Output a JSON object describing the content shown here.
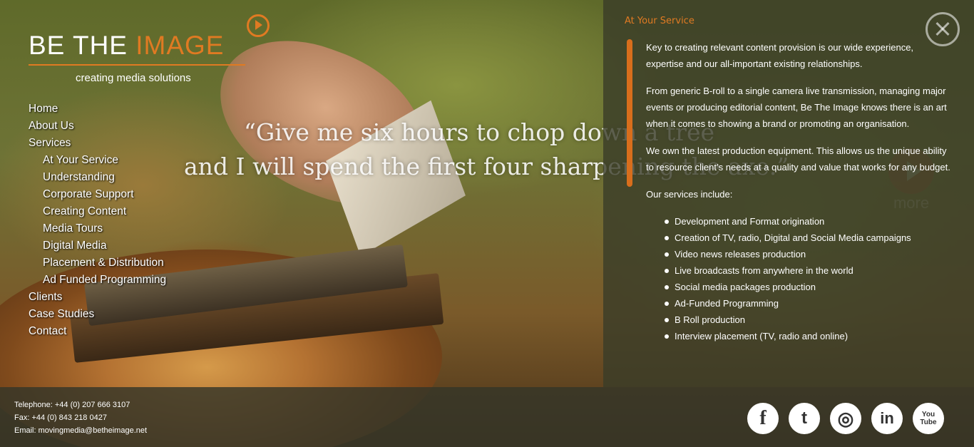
{
  "brand": {
    "logo_part1": "BE THE ",
    "logo_part2": "IMAGE",
    "tagline": "creating media solutions",
    "accent_color": "#e07a22"
  },
  "nav": {
    "items": [
      {
        "label": "Home",
        "level": 1
      },
      {
        "label": "About Us",
        "level": 1
      },
      {
        "label": "Services",
        "level": 1
      },
      {
        "label": "At Your Service",
        "level": 2
      },
      {
        "label": "Understanding",
        "level": 2
      },
      {
        "label": "Corporate Support",
        "level": 2
      },
      {
        "label": "Creating Content",
        "level": 2
      },
      {
        "label": "Media Tours",
        "level": 2
      },
      {
        "label": "Digital Media",
        "level": 2
      },
      {
        "label": "Placement & Distribution",
        "level": 2
      },
      {
        "label": "Ad Funded Programming",
        "level": 2
      },
      {
        "label": "Clients",
        "level": 1
      },
      {
        "label": "Case Studies",
        "level": 1
      },
      {
        "label": "Contact",
        "level": 1
      }
    ]
  },
  "quote": {
    "line1": "“Give me six hours to chop down a tree",
    "line2": "and I will spend the first four sharpening the axe.”"
  },
  "panel": {
    "heading": "At Your Service",
    "paragraphs": [
      "Key to creating relevant content provision is our wide experience, expertise and our all-important existing relationships.",
      "From generic B-roll to a single camera live transmission, managing major events or producing editorial content, Be The Image knows there is an art when it comes to showing a brand or promoting an organisation.",
      "We own the latest production equipment. This allows us the unique ability to resource client’s needs at a quality and value that works for any budget.",
      "Our services include:"
    ],
    "services": [
      "Development and Format origination",
      "Creation of TV, radio, Digital and Social Media campaigns",
      "Video news releases production",
      "Live broadcasts from anywhere in the world",
      "Social media packages production",
      "Ad-Funded Programming",
      "B Roll production",
      "Interview placement (TV, radio and online)"
    ]
  },
  "more": {
    "label": "more"
  },
  "footer": {
    "telephone": "Telephone: +44 (0) 207 666 3107",
    "fax": "Fax: +44 (0) 843 218 0427",
    "email": "Email: movingmedia@betheimage.net"
  },
  "social": [
    {
      "icon": "facebook-icon",
      "glyph": "f"
    },
    {
      "icon": "twitter-icon",
      "glyph": "t"
    },
    {
      "icon": "instagram-icon",
      "glyph": "◎"
    },
    {
      "icon": "linkedin-icon",
      "glyph": "in"
    },
    {
      "icon": "youtube-icon",
      "glyph": "You\nTube"
    }
  ]
}
